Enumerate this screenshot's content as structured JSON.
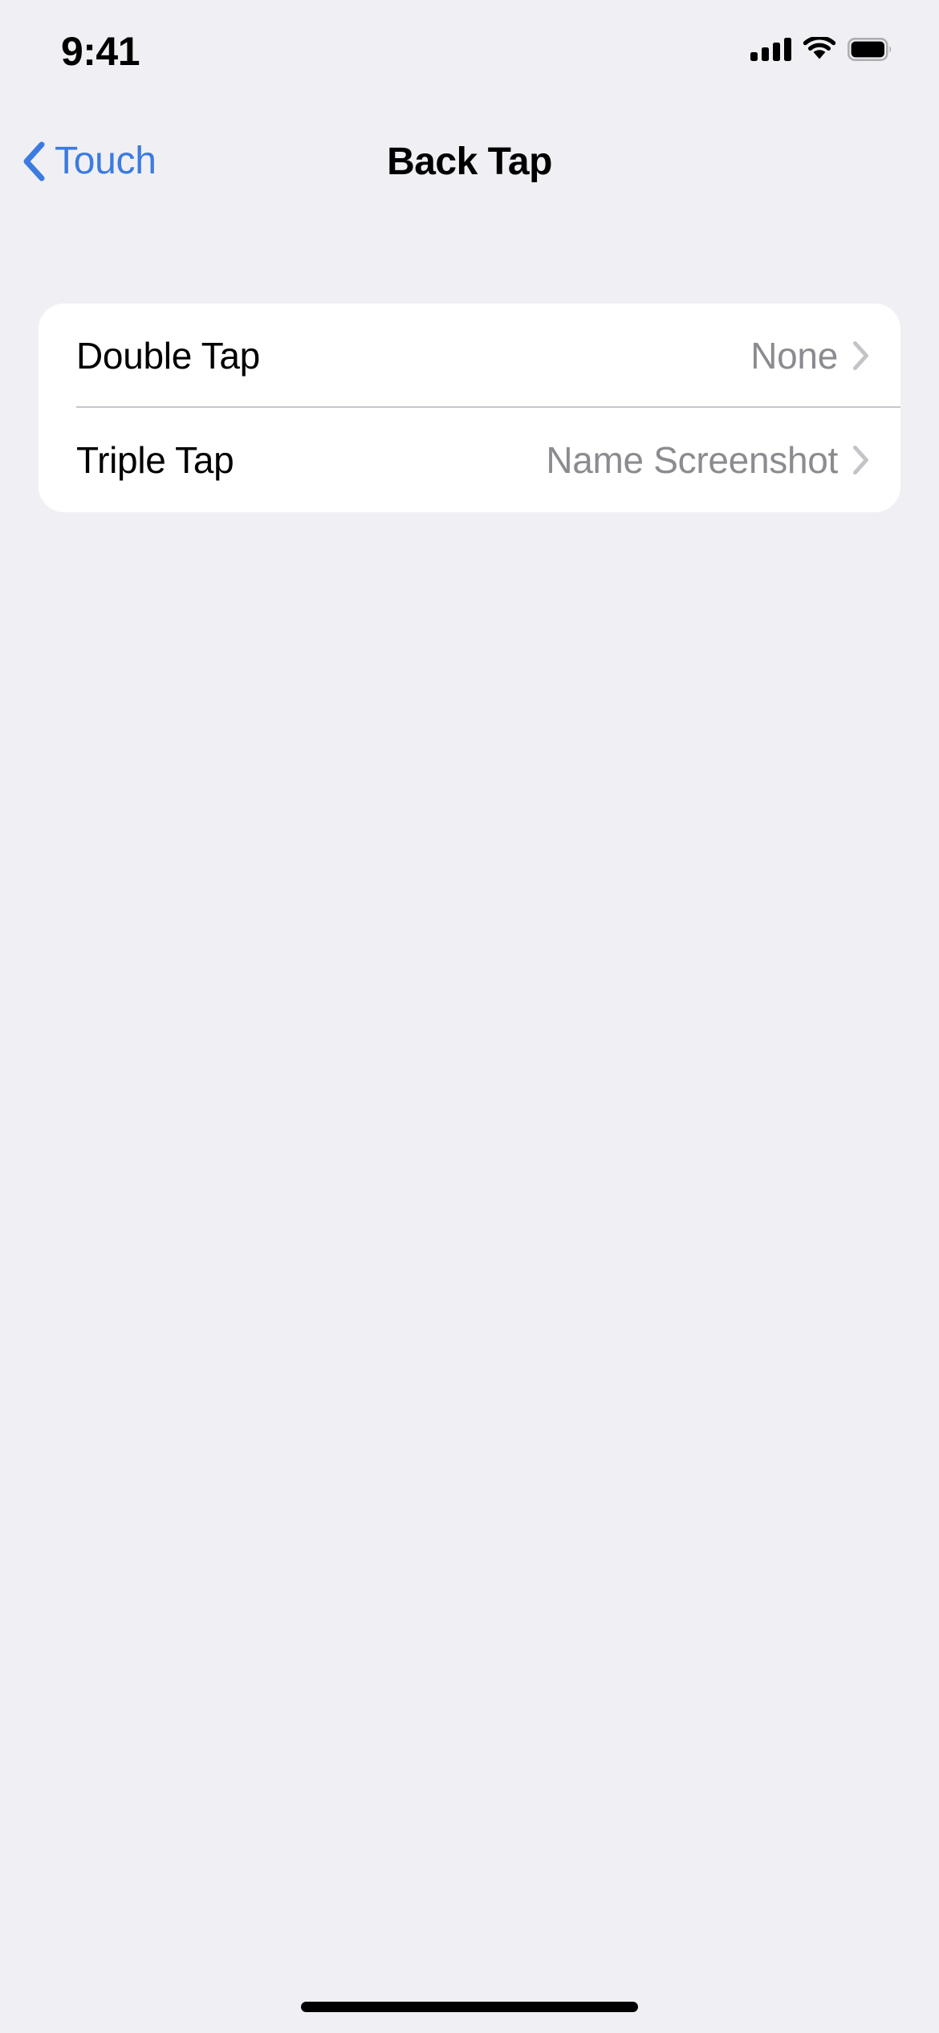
{
  "status_bar": {
    "time": "9:41",
    "cellular_icon": "cellular-signal-icon",
    "cellular_bars": 4,
    "wifi_icon": "wifi-icon",
    "battery_icon": "battery-full-icon"
  },
  "nav": {
    "back_label": "Touch",
    "back_icon": "chevron-left-icon",
    "title": "Back Tap"
  },
  "settings_list": {
    "rows": [
      {
        "label": "Double Tap",
        "value": "None",
        "disclosure_icon": "chevron-right-icon"
      },
      {
        "label": "Triple Tap",
        "value": "Name Screenshot",
        "disclosure_icon": "chevron-right-icon"
      }
    ]
  },
  "home_indicator": {
    "name": "home-indicator"
  },
  "colors": {
    "background": "#F0F0F4",
    "card": "#FFFFFF",
    "accent_blue": "#3C7BE0",
    "secondary_text": "#8B8B90",
    "separator": "#C8C7CC",
    "primary_text": "#000000"
  }
}
